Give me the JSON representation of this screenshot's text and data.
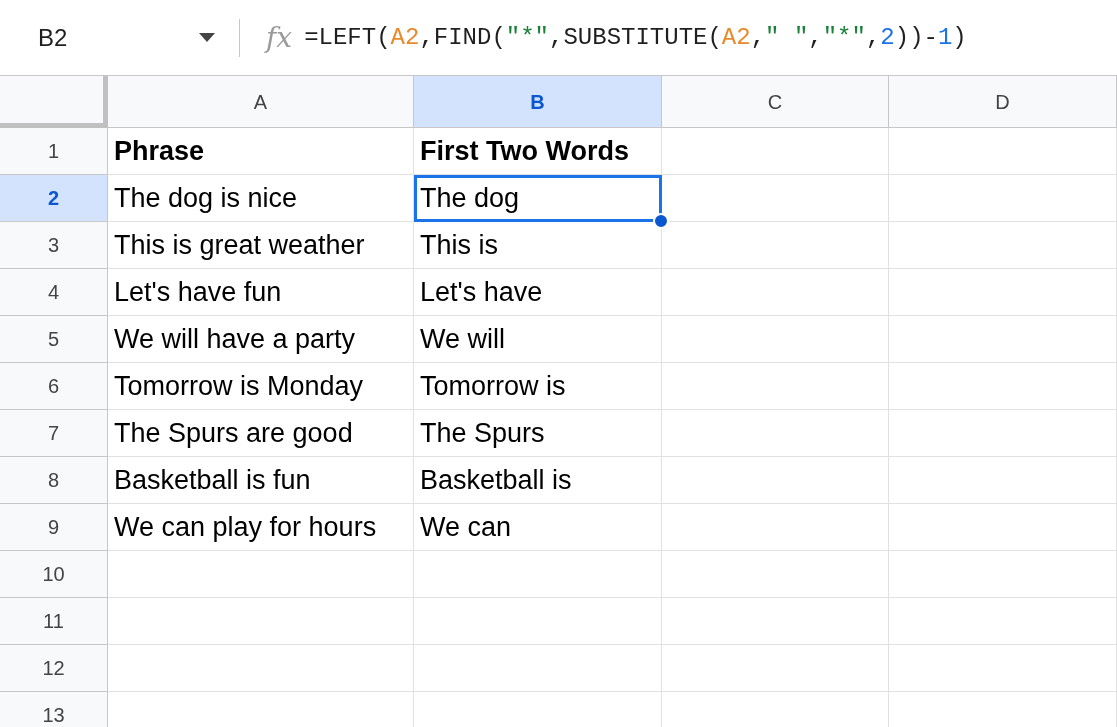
{
  "formula_bar": {
    "name_box": "B2",
    "fx": "fx",
    "formula": [
      {
        "text": "=LEFT(",
        "kind": "plain"
      },
      {
        "text": "A2",
        "kind": "ref"
      },
      {
        "text": ",FIND(",
        "kind": "plain"
      },
      {
        "text": "\"*\"",
        "kind": "string"
      },
      {
        "text": ",SUBSTITUTE(",
        "kind": "plain"
      },
      {
        "text": "A2",
        "kind": "ref"
      },
      {
        "text": ",",
        "kind": "plain"
      },
      {
        "text": "\" \"",
        "kind": "string"
      },
      {
        "text": ",",
        "kind": "plain"
      },
      {
        "text": "\"*\"",
        "kind": "string"
      },
      {
        "text": ",",
        "kind": "plain"
      },
      {
        "text": "2",
        "kind": "number"
      },
      {
        "text": "))-",
        "kind": "plain"
      },
      {
        "text": "1",
        "kind": "number"
      },
      {
        "text": ")",
        "kind": "plain"
      }
    ]
  },
  "columns": [
    {
      "label": "A",
      "selected": false
    },
    {
      "label": "B",
      "selected": true
    },
    {
      "label": "C",
      "selected": false
    },
    {
      "label": "D",
      "selected": false
    }
  ],
  "rows": [
    {
      "number": "1",
      "selected": false,
      "cells": [
        {
          "text": "Phrase",
          "bold": true,
          "selected": false
        },
        {
          "text": "First Two Words",
          "bold": true,
          "selected": false
        }
      ]
    },
    {
      "number": "2",
      "selected": true,
      "cells": [
        {
          "text": "The dog is nice",
          "bold": false,
          "selected": false
        },
        {
          "text": "The dog",
          "bold": false,
          "selected": true
        }
      ]
    },
    {
      "number": "3",
      "selected": false,
      "cells": [
        {
          "text": "This is great weather",
          "bold": false,
          "selected": false
        },
        {
          "text": "This is",
          "bold": false,
          "selected": false
        }
      ]
    },
    {
      "number": "4",
      "selected": false,
      "cells": [
        {
          "text": "Let's have fun",
          "bold": false,
          "selected": false
        },
        {
          "text": "Let's have",
          "bold": false,
          "selected": false
        }
      ]
    },
    {
      "number": "5",
      "selected": false,
      "cells": [
        {
          "text": "We will have a party",
          "bold": false,
          "selected": false
        },
        {
          "text": "We will",
          "bold": false,
          "selected": false
        }
      ]
    },
    {
      "number": "6",
      "selected": false,
      "cells": [
        {
          "text": "Tomorrow is Monday",
          "bold": false,
          "selected": false
        },
        {
          "text": "Tomorrow is",
          "bold": false,
          "selected": false
        }
      ]
    },
    {
      "number": "7",
      "selected": false,
      "cells": [
        {
          "text": "The Spurs are good",
          "bold": false,
          "selected": false
        },
        {
          "text": "The Spurs",
          "bold": false,
          "selected": false
        }
      ]
    },
    {
      "number": "8",
      "selected": false,
      "cells": [
        {
          "text": "Basketball is fun",
          "bold": false,
          "selected": false
        },
        {
          "text": "Basketball is",
          "bold": false,
          "selected": false
        }
      ]
    },
    {
      "number": "9",
      "selected": false,
      "cells": [
        {
          "text": "We can play for hours",
          "bold": false,
          "selected": false
        },
        {
          "text": "We can",
          "bold": false,
          "selected": false
        }
      ]
    },
    {
      "number": "10",
      "selected": false,
      "cells": []
    },
    {
      "number": "11",
      "selected": false,
      "cells": []
    },
    {
      "number": "12",
      "selected": false,
      "cells": []
    },
    {
      "number": "13",
      "selected": false,
      "cells": []
    }
  ]
}
